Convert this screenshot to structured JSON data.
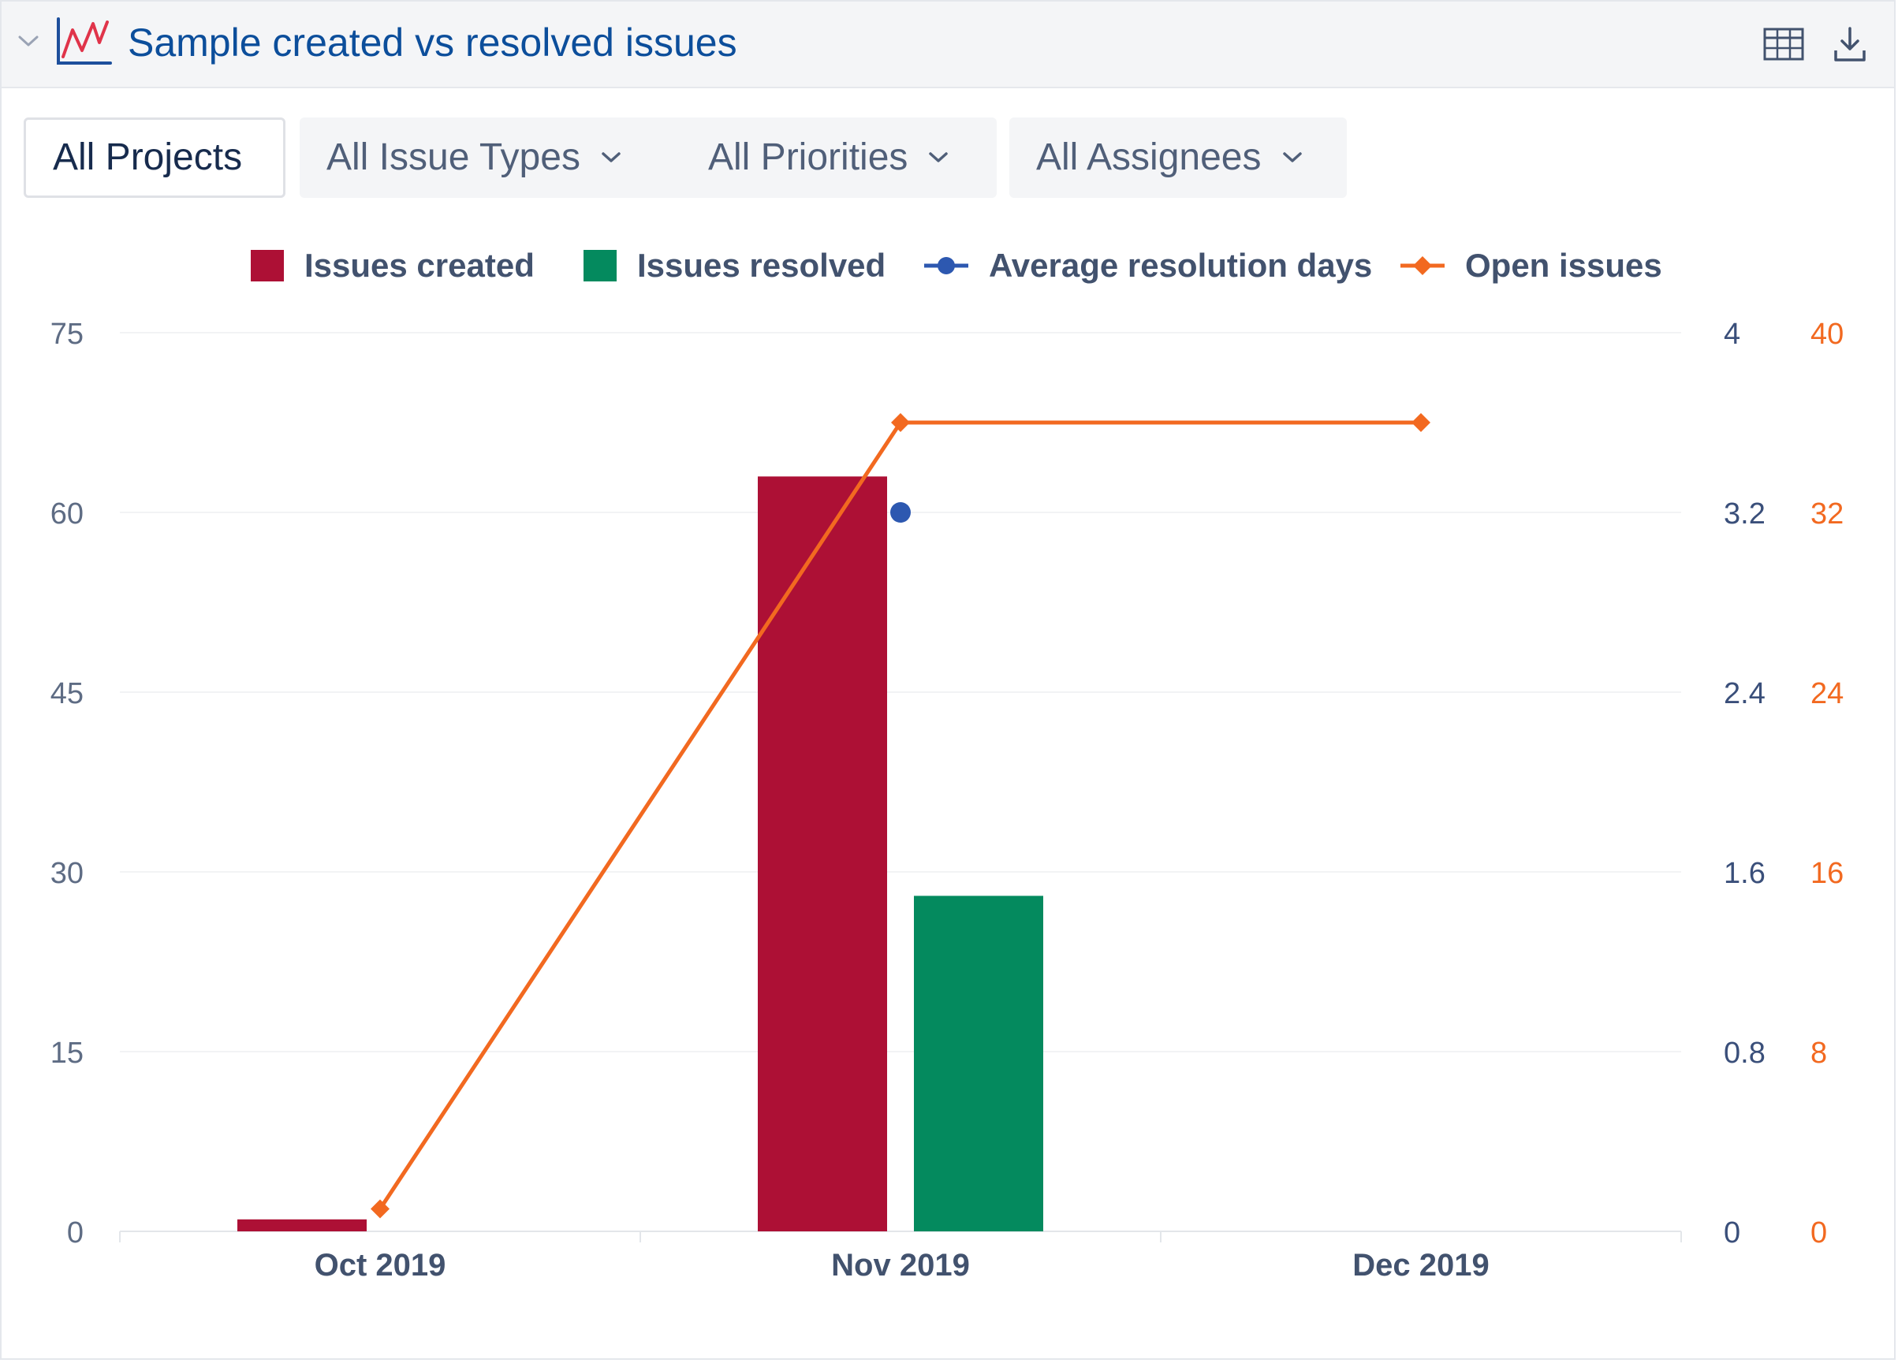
{
  "header": {
    "title": "Sample created vs resolved issues",
    "icons": [
      "chevron-down-icon",
      "line-chart-icon",
      "table-icon",
      "download-icon"
    ]
  },
  "filters": [
    {
      "label": "All Projects",
      "active": true
    },
    {
      "label": "All Issue Types",
      "dropdown": true
    },
    {
      "label": "All Priorities",
      "dropdown": true
    },
    {
      "label": "All Assignees",
      "dropdown": true
    }
  ],
  "legend": [
    {
      "label": "Issues created",
      "color": "#ad1035",
      "shape": "square"
    },
    {
      "label": "Issues resolved",
      "color": "#048a5e",
      "shape": "square"
    },
    {
      "label": "Average resolution days",
      "color": "#2d58b0",
      "shape": "line-circle"
    },
    {
      "label": "Open issues",
      "color": "#f26920",
      "shape": "line-diamond"
    }
  ],
  "chart_data": {
    "type": "bar",
    "categories": [
      "Oct 2019",
      "Nov 2019",
      "Dec 2019"
    ],
    "series": [
      {
        "name": "Issues created",
        "type": "bar",
        "axis": "left",
        "color": "#ad1035",
        "values": [
          1,
          63,
          null
        ]
      },
      {
        "name": "Issues resolved",
        "type": "bar",
        "axis": "left",
        "color": "#048a5e",
        "values": [
          null,
          28,
          null
        ]
      },
      {
        "name": "Average resolution days",
        "type": "scatter",
        "axis": "right-1",
        "color": "#2d58b0",
        "values": [
          null,
          3.2,
          null
        ]
      },
      {
        "name": "Open issues",
        "type": "line",
        "axis": "right-2",
        "color": "#f26920",
        "values": [
          1,
          36,
          36
        ]
      }
    ],
    "y_left": {
      "ylim": [
        0,
        75
      ],
      "ticks": [
        "0",
        "15",
        "30",
        "45",
        "60",
        "75"
      ]
    },
    "y_right_1": {
      "ylim": [
        0,
        4
      ],
      "ticks": [
        "0",
        "0.8",
        "1.6",
        "2.4",
        "3.2",
        "4"
      ],
      "color": "#3a4f7a"
    },
    "y_right_2": {
      "ylim": [
        0,
        40
      ],
      "ticks": [
        "0",
        "8",
        "16",
        "24",
        "32",
        "40"
      ],
      "color": "#f26920"
    },
    "grid": true,
    "legend_position": "top"
  }
}
